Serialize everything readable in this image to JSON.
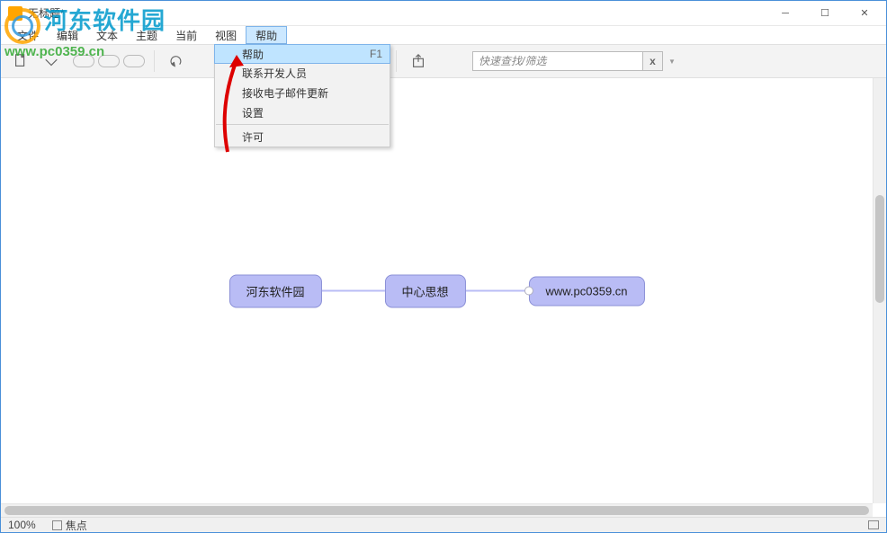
{
  "window": {
    "title": "无标题*"
  },
  "menubar": {
    "items": [
      "文件",
      "编辑",
      "文本",
      "主题",
      "当前",
      "视图",
      "帮助"
    ]
  },
  "help_menu": {
    "items": [
      {
        "label": "帮助",
        "shortcut": "F1",
        "highlight": true
      },
      {
        "label": "联系开发人员"
      },
      {
        "label": "接收电子邮件更新"
      },
      {
        "label": "设置"
      },
      {
        "sep": true
      },
      {
        "label": "许可"
      }
    ]
  },
  "search": {
    "placeholder": "快速查找/筛选",
    "close": "x"
  },
  "mindmap": {
    "left_node": "河东软件园",
    "center_node": "中心思想",
    "right_node": "www.pc0359.cn"
  },
  "statusbar": {
    "zoom": "100%",
    "focus_label": "焦点"
  },
  "watermark": {
    "text": "河东软件园",
    "url": "www.pc0359.cn"
  }
}
